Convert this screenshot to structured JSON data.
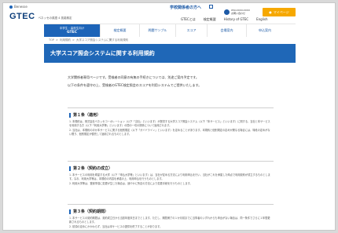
{
  "header": {
    "benesse_label": "Benesse",
    "for_school": "学校関係者の方へ",
    "logo": "GTEC",
    "tagline": "ベネッセの英語 4 技能検定",
    "contact_line1": "050-XXXX-XXXX",
    "contact_line2": "お問い合わせ",
    "my_page_label": "マイページ",
    "util_nav": [
      "GTECとは",
      "検定概要",
      "History of GTEC",
      "English"
    ]
  },
  "nav": {
    "active_top": "中学生・高校生向け",
    "active_sub": "GTEC",
    "items": [
      "検定概要",
      "問題サンプル",
      "スコア",
      "会場案内",
      "申込案内"
    ]
  },
  "breadcrumb": [
    "TOP",
    "利用規約",
    "大学スコア照会システムに関する利用規約"
  ],
  "hero_title": "大学スコア照会システムに関する利用規約",
  "intro": [
    "大学関係者専用ページです。受検者の同意の有無の手続きについては、別途ご案内予定です。",
    "以下の条件を遵守の上、受検者のGTEC検定照会のスコアを利用システムでご提供いたします。"
  ],
  "articles": [
    {
      "heading": "第１条（適用）",
      "paragraphs": [
        "1. 本規約は、株式会社ベネッセコーポレーション（以下「当社」といいます）が提供する大学スコア照会システム（以下「本サービス」といいます）に関する、当社と本サービスを利用する方（以下「利用大学等」といいます）の間の一切の関係について適用されます。",
        "2. 当社は、本規約のほか本サービスに関する個別規定（以下「ガイドライン」といいます）を定めることがあります。本規約と個別規定の定めが異なる場合には、特段の定めがない限り、個別規定が優先して適用されるものとします。"
      ]
    },
    {
      "heading": "第２条（契約の成立）",
      "paragraphs": [
        "1. 本サービスの利用を希望する大学（以下「申込大学等」といいます）は、当社が定める方法により利用申込を行い、当社がこれを承諾した時点で利用契約が成立するものとします。なお、利用大学等は、本規約の内容を承諾の上、利用申込を行うものとします。",
        "2. 利用大学等は、登録事項に変更が生じた場合は、速やかに所定の方法により変更手続を行うものとします。"
      ]
    },
    {
      "heading": "第３条（契約期間）",
      "paragraphs": [
        "1. 本サービスの契約期間は、契約成立日から当該年度末日までとします。ただし、期間満了の１か月前までに当事者のいずれからも申出がない場合は、同一条件でさらに１年間更新されるものとします。",
        "2. 前項の定めにかかわらず、当社は本サービスの提供を終了することがあります。"
      ]
    }
  ],
  "colors": {
    "brand_blue": "#1d64b8",
    "logo_navy": "#0b3d7a",
    "my_page_orange": "#f6a800"
  }
}
